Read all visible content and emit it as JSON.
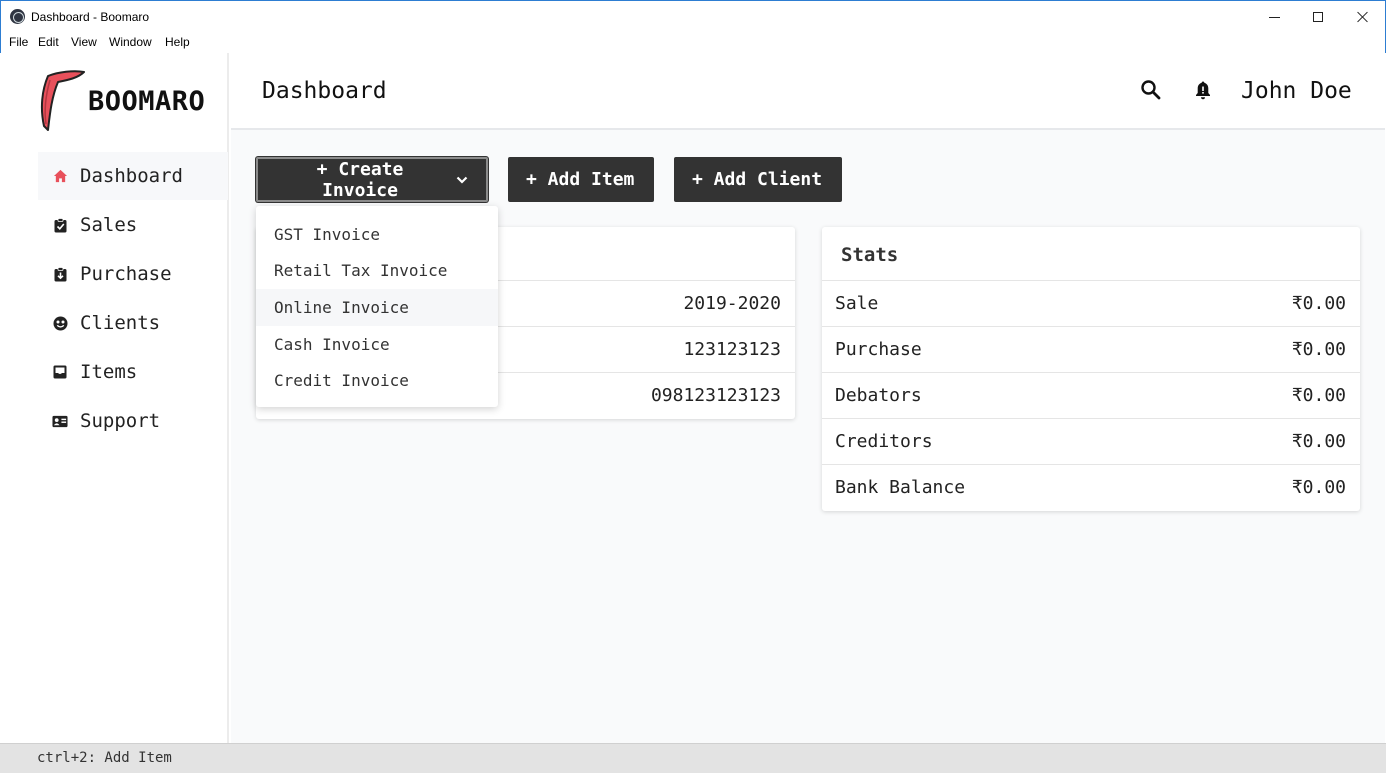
{
  "window": {
    "title": "Dashboard - Boomaro",
    "icon": "electron-icon",
    "controls": [
      "minimize-icon",
      "maximize-icon",
      "close-icon"
    ]
  },
  "menu": [
    "File",
    "Edit",
    "View",
    "Window",
    "Help"
  ],
  "brand": {
    "name": "BOOMARO",
    "logo": "boomerang-icon",
    "logo_color": "#e8505b"
  },
  "sidebar": {
    "items": [
      {
        "label": "Dashboard",
        "icon": "home-icon",
        "active": true
      },
      {
        "label": "Sales",
        "icon": "clipboard-icon"
      },
      {
        "label": "Purchase",
        "icon": "clipboard-download-icon"
      },
      {
        "label": "Clients",
        "icon": "smiley-icon"
      },
      {
        "label": "Items",
        "icon": "inbox-icon"
      },
      {
        "label": "Support",
        "icon": "contact-card-icon"
      }
    ]
  },
  "header": {
    "title": "Dashboard",
    "icons": [
      "search-icon",
      "bell-icon"
    ],
    "user": "John Doe"
  },
  "actions": {
    "create_invoice": "+ Create Invoice",
    "add_item": "+ Add Item",
    "add_client": "+ Add Client"
  },
  "invoice_menu": {
    "items": [
      "GST Invoice",
      "Retail Tax Invoice",
      "Online Invoice",
      "Cash Invoice",
      "Credit Invoice"
    ],
    "hovered": "Online Invoice"
  },
  "info_card": {
    "rows": [
      {
        "value": "2019-2020"
      },
      {
        "value": "123123123"
      },
      {
        "value": "098123123123"
      }
    ]
  },
  "stats": {
    "title": "Stats",
    "rows": [
      {
        "label": "Sale",
        "value": "₹0.00"
      },
      {
        "label": "Purchase",
        "value": "₹0.00"
      },
      {
        "label": "Debators",
        "value": "₹0.00"
      },
      {
        "label": "Creditors",
        "value": "₹0.00"
      },
      {
        "label": "Bank Balance",
        "value": "₹0.00"
      }
    ]
  },
  "statusbar": {
    "text": "ctrl+2: Add Item"
  },
  "colors": {
    "accent": "#e8505b",
    "button": "#333333",
    "background": "#f9fafb"
  }
}
